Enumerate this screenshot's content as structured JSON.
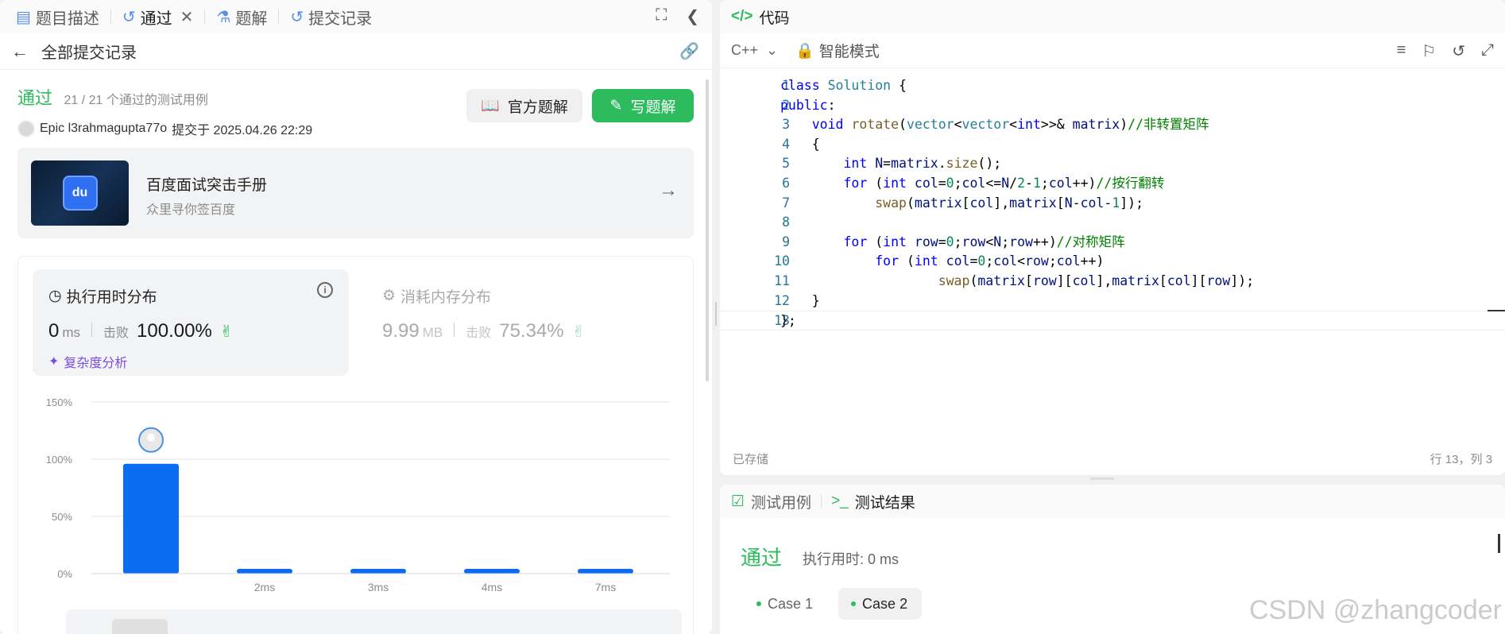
{
  "left_tabs": [
    {
      "label": "题目描述",
      "icon": "document-icon"
    },
    {
      "label": "通过",
      "icon": "history-icon",
      "active": true
    },
    {
      "label": "题解",
      "icon": "flask-icon"
    },
    {
      "label": "提交记录",
      "icon": "history-icon"
    }
  ],
  "backbar": {
    "title": "全部提交记录"
  },
  "submission": {
    "status": "通过",
    "pass_count": "21 / 21 个通过的测试用例",
    "author": "Epic l3rahmagupta77o",
    "submitted_at": "提交于 2025.04.26 22:29",
    "btn_official": "官方题解",
    "btn_write": "写题解"
  },
  "promo": {
    "title": "百度面试突击手册",
    "subtitle": "众里寻你签百度",
    "logo_text": "du"
  },
  "runtime": {
    "title": "执行用时分布",
    "value": "0",
    "unit": "ms",
    "beat_label": "击败",
    "beat_value": "100.00%",
    "analysis": "复杂度分析"
  },
  "memory": {
    "title": "消耗内存分布",
    "value": "9.99",
    "unit": "MB",
    "beat_label": "击败",
    "beat_value": "75.34%"
  },
  "chart_data": {
    "type": "bar",
    "categories": [
      "0ms",
      "2ms",
      "3ms",
      "4ms",
      "7ms"
    ],
    "tick_labels": [
      "",
      "2ms",
      "3ms",
      "4ms",
      "7ms"
    ],
    "values": [
      96,
      3,
      3,
      3,
      3
    ],
    "y_ticks": [
      "0%",
      "50%",
      "100%",
      "150%"
    ],
    "ylim": [
      0,
      150
    ],
    "bar_color": "#0a6cf0",
    "highlight_index": 0
  },
  "code": {
    "header": "代码",
    "language": "C++",
    "mode": "智能模式",
    "saved": "已存储",
    "cursor_pos": "行 13，列 3",
    "lines": [
      "class Solution {",
      "public:",
      "    void rotate(vector<vector<int>>& matrix)//非转置矩阵",
      "    {",
      "        int N=matrix.size();",
      "        for (int col=0;col<=N/2-1;col++)//按行翻转",
      "            swap(matrix[col],matrix[N-col-1]);",
      "",
      "        for (int row=0;row<N;row++)//对称矩阵",
      "            for (int col=0;col<row;col++)",
      "                    swap(matrix[row][col],matrix[col][row]);",
      "    }",
      "};"
    ]
  },
  "result_tabs": [
    {
      "label": "测试用例",
      "icon": "checkbox-icon"
    },
    {
      "label": "测试结果",
      "icon": "terminal-icon",
      "active": true
    }
  ],
  "test_result": {
    "status": "通过",
    "runtime": "执行用时: 0 ms",
    "cases": [
      "Case 1",
      "Case 2"
    ],
    "selected_case": 1
  },
  "watermark": "CSDN @zhangcoder",
  "colors": {
    "accent": "#2cbb5d",
    "bar": "#0a6cf0",
    "purple": "#7a4cdf"
  }
}
